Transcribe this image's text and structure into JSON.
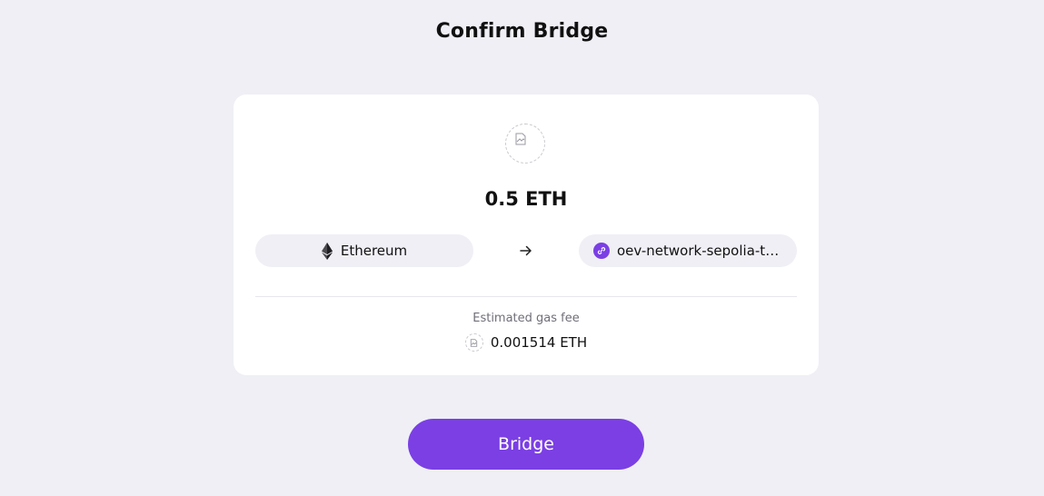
{
  "page": {
    "title": "Confirm Bridge"
  },
  "transfer": {
    "token_icon": "broken-image-icon",
    "amount": "0.5 ETH",
    "from_chain": {
      "label": "Ethereum",
      "icon": "ethereum-icon"
    },
    "to_chain": {
      "label": "oev-network-sepolia-testnet",
      "icon": "chain-link-icon"
    },
    "arrow_icon": "arrow-right-icon"
  },
  "fee": {
    "label": "Estimated gas fee",
    "value": "0.001514 ETH",
    "icon": "broken-image-icon"
  },
  "actions": {
    "bridge_label": "Bridge"
  },
  "colors": {
    "background": "#efeff5",
    "card": "#ffffff",
    "accent": "#7b3fe4",
    "muted_text": "#6f6f78"
  }
}
